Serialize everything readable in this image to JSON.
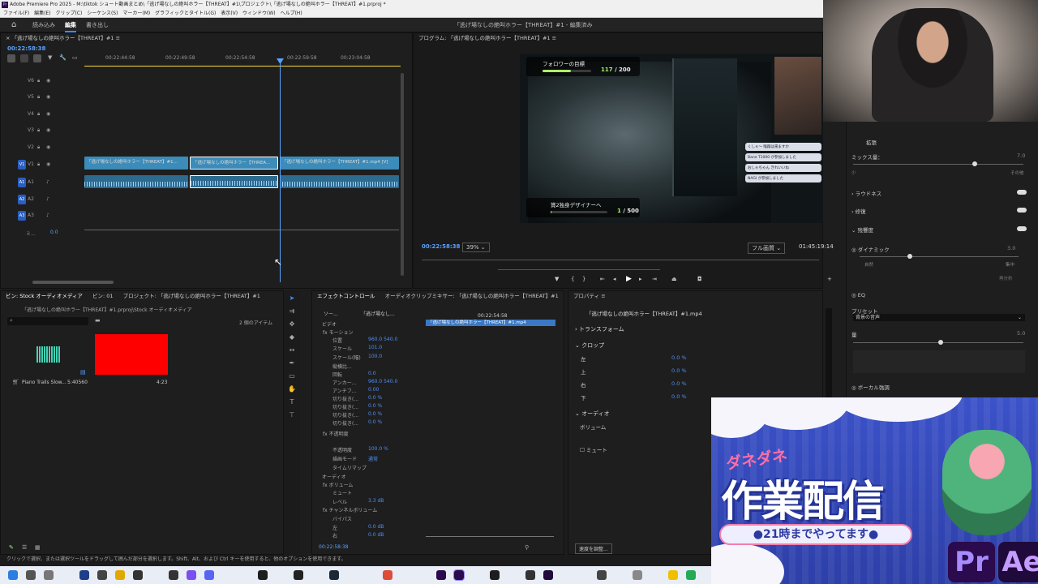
{
  "app": {
    "title": "Adobe Premiere Pro 2025 - M:\\tiktok ショート動画まとめ\\「逃げ場なしの絶叫ホラー【THREAT】#1\\プロジェクト\\「逃げ場なしの絶叫ホラー【THREAT】#1.prproj *",
    "logo": "Pr"
  },
  "menu": [
    "ファイル(F)",
    "編集(E)",
    "クリップ(C)",
    "シーケンス(S)",
    "マーカー(M)",
    "グラフィックとタイトル(G)",
    "表示(V)",
    "ウィンドウ(W)",
    "ヘルプ(H)"
  ],
  "workspace": {
    "tabs": [
      "読み込み",
      "編集",
      "書き出し"
    ],
    "active": "編集",
    "sequence_title": "「逃げ場なしの絶叫ホラー【THREAT】#1 - 編集済み"
  },
  "timeline": {
    "tab_title": "「逃げ場なしの絶叫ホラー【THREAT】#1",
    "timecode": "00:22:58:38",
    "ruler": [
      "00:22:44:58",
      "00:22:49:58",
      "00:22:54:58",
      "00:22:59:58",
      "00:23:04:58"
    ],
    "tracks": [
      "V6",
      "V5",
      "V4",
      "V3",
      "V2",
      "V1",
      "A1",
      "A2",
      "A3",
      "ミ..."
    ],
    "mix_value": "0.0",
    "clips": [
      "「逃げ場なしの絶叫ホラー【THREAT】#1...",
      "「逃げ場なしの絶叫ホラー【THREA...",
      "「逃げ場なしの絶叫ホラー【THREAT】#1.mp4 [V]"
    ]
  },
  "program": {
    "tab_title": "プログラム: 「逃げ場なしの絶叫ホラー【THREAT】#1",
    "timecode": "00:22:58:38",
    "zoom": "39%",
    "quality": "フル画質",
    "duration": "01:45:19:14",
    "overlay": {
      "goal1_label": "フォロワーの目標",
      "goal1_current": "117",
      "goal1_total": "/ 200",
      "goal1_progress": 0.585,
      "goal2_label": "賞2独身デザイナーへ",
      "goal2_current": "1",
      "goal2_total": "/ 500",
      "goal2_progress": 0.002,
      "chat": [
        "くしゃ〜 喉蹴は来ますか",
        "Bane T1000 が参加しました",
        "おしゃちゃん きれいいね",
        "NAGI が参加しました"
      ]
    }
  },
  "bins": {
    "tabs": [
      "ビン: Stock オーディオメディア",
      "ビン: 01",
      "プロジェクト: 「逃げ場なしの絶叫ホラー【THREAT】#1"
    ],
    "path": "「逃げ場なしの絶叫ホラー【THREAT】#1.prproj\\Stock オーディオメディア",
    "item_count": "2 個のアイテム",
    "items": [
      {
        "name": "Piano Trails Slow...",
        "duration": "5:40560"
      },
      {
        "name": "",
        "duration": "4:23"
      }
    ]
  },
  "effects": {
    "tabs": [
      "エフェクトコントロール",
      "オーディオクリップミキサー: 「逃げ場なしの絶叫ホラー【THREAT】#1"
    ],
    "source_tab": "ソー...",
    "seq_tab": "「逃げ場なし...",
    "timecode": "00:22:54:58",
    "clip_label": "「逃げ場なしの絶叫ホラー【THREAT】#1.mp4",
    "sections": {
      "video": "ビデオ",
      "audio": "オーディオ"
    },
    "rows": [
      {
        "label": "fx モーション",
        "value": ""
      },
      {
        "label": "位置",
        "value": "960.0   540.0"
      },
      {
        "label": "スケール",
        "value": "101.0"
      },
      {
        "label": "スケール(幅)",
        "value": "100.0"
      },
      {
        "label": "縦横比...",
        "value": ""
      },
      {
        "label": "回転",
        "value": "0.0"
      },
      {
        "label": "アンカー...",
        "value": "960.0   540.0"
      },
      {
        "label": "アンチフ...",
        "value": "0.00"
      },
      {
        "label": "切り抜き(...",
        "value": "0.0 %"
      },
      {
        "label": "切り抜き(...",
        "value": "0.0 %"
      },
      {
        "label": "切り抜き(...",
        "value": "0.0 %"
      },
      {
        "label": "切り抜き(...",
        "value": "0.0 %"
      },
      {
        "label": "fx 不透明度",
        "value": ""
      },
      {
        "label": "不透明度",
        "value": "100.0 %"
      },
      {
        "label": "描画モード",
        "value": "通常"
      },
      {
        "label": "タイムリマップ",
        "value": ""
      },
      {
        "label": "fx ボリューム",
        "value": ""
      },
      {
        "label": "ミュート",
        "value": ""
      },
      {
        "label": "レベル",
        "value": "3.3 dB"
      },
      {
        "label": "fx チャンネルボリューム",
        "value": ""
      },
      {
        "label": "バイパス",
        "value": ""
      },
      {
        "label": "左",
        "value": "0.0 dB"
      },
      {
        "label": "右",
        "value": "0.0 dB"
      }
    ],
    "footer_timecode": "00:22:58:38"
  },
  "properties": {
    "tab": "プロパティ",
    "clip": "「逃げ場なしの絶叫ホラー【THREAT】#1.mp4",
    "transform": "トランスフォーム",
    "crop": "クロップ",
    "crop_rows": [
      {
        "label": "左",
        "value": "0.0 %"
      },
      {
        "label": "上",
        "value": "0.0 %"
      },
      {
        "label": "右",
        "value": "0.0 %"
      },
      {
        "label": "下",
        "value": "0.0 %"
      }
    ],
    "audio": "オーディオ",
    "volume": "ボリューム",
    "mute": "ミュート",
    "adjust_speed": "速度を調整..."
  },
  "audio_panel": {
    "tab": "拡張",
    "mix_amount": "ミックス量：",
    "mix_value": "7.0",
    "mix_range_low": "少",
    "mix_range_high": "その他",
    "mix_level": 0.7,
    "loudness": "ラウドネス",
    "repair": "修復",
    "reverb": "残響度",
    "dynamics": "ダイナミック",
    "dynamics_value": "3.0",
    "dynamics_low": "自然",
    "dynamics_high": "集中",
    "dynamics_level": 0.3,
    "reanalyze": "再分析",
    "eq": "EQ",
    "preset": "プリセット",
    "preset_value": "背景の音声",
    "amount": "量",
    "amount_value": "5.0",
    "amount_level": 0.5,
    "vocal": "ボーカル強調"
  },
  "banner": {
    "kana": "ダネダネ",
    "title": "作業配信",
    "subtitle": "●21時までやってます●",
    "app1": "Pr",
    "app2": "Ae",
    "colors": {
      "bg": "#3b52c9",
      "pink": "#ff6fa8",
      "pr": "#2b0a4d",
      "ae": "#1f0a3b"
    }
  },
  "status": "クリックで選択、または選択ツールをドラッグして囲んだ部分を選択します。Shift、Alt、および Ctrl キーを使用すると、他のオプションを使用できます。"
}
